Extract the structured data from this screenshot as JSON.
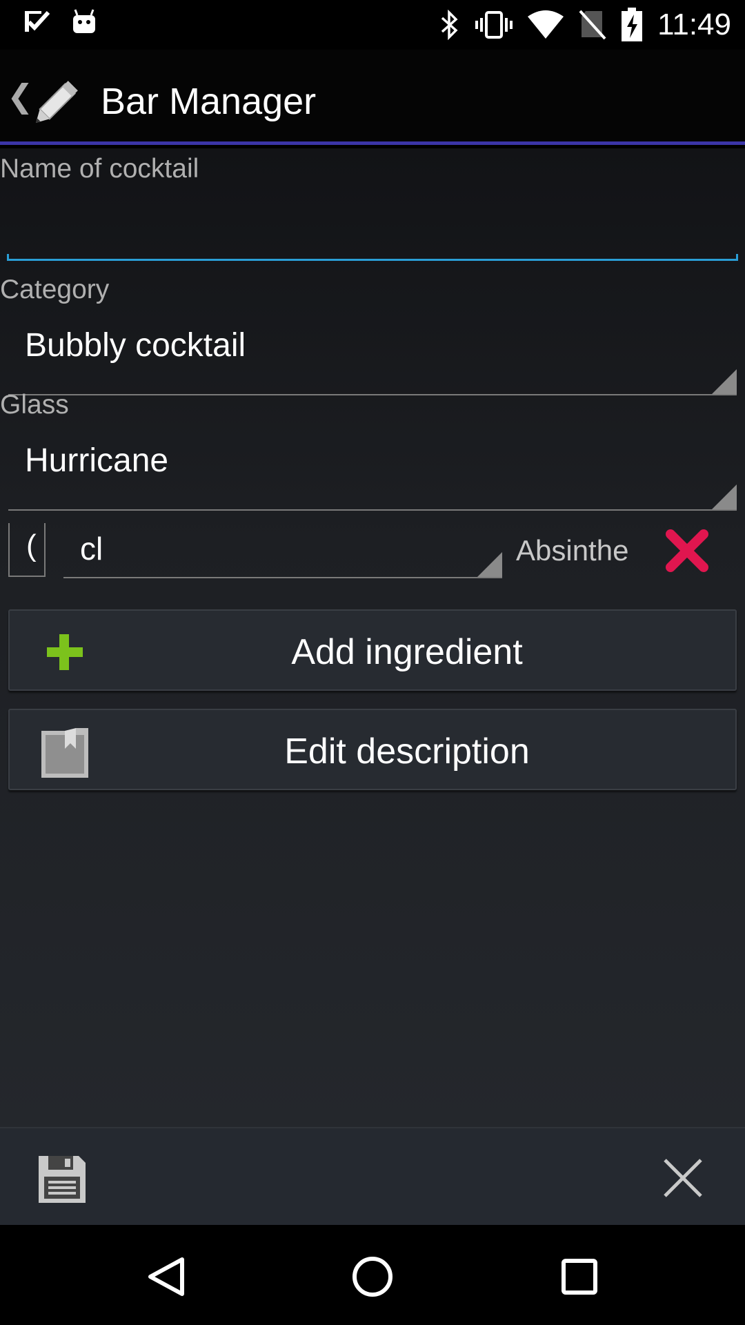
{
  "status_bar": {
    "time": "11:49",
    "icons": [
      "checkmark-notification-icon",
      "android-icon",
      "bluetooth-icon",
      "vibrate-icon",
      "wifi-icon",
      "no-sim-icon",
      "battery-charging-icon"
    ]
  },
  "action_bar": {
    "title": "Bar Manager",
    "up_caret": "❮",
    "icon": "pencil-icon"
  },
  "form": {
    "name_label": "Name of cocktail",
    "name_value": "",
    "category_label": "Category",
    "category_value": "Bubbly cocktail",
    "glass_label": "Glass",
    "glass_value": "Hurricane"
  },
  "ingredient": {
    "quantity": "(",
    "unit": "cl",
    "name": "Absinthe",
    "remove_icon": "red-x-icon"
  },
  "buttons": {
    "add_ingredient": "Add ingredient",
    "edit_description": "Edit description"
  },
  "colors": {
    "accent_line": "#3b35a8",
    "focus_line": "#2a9ed6",
    "remove": "#e0164f",
    "add": "#7cc21c"
  },
  "bottom_bar": {
    "save_icon": "save-icon",
    "close_icon": "close-icon"
  },
  "nav_bar": [
    "back-icon",
    "home-icon",
    "recents-icon"
  ]
}
